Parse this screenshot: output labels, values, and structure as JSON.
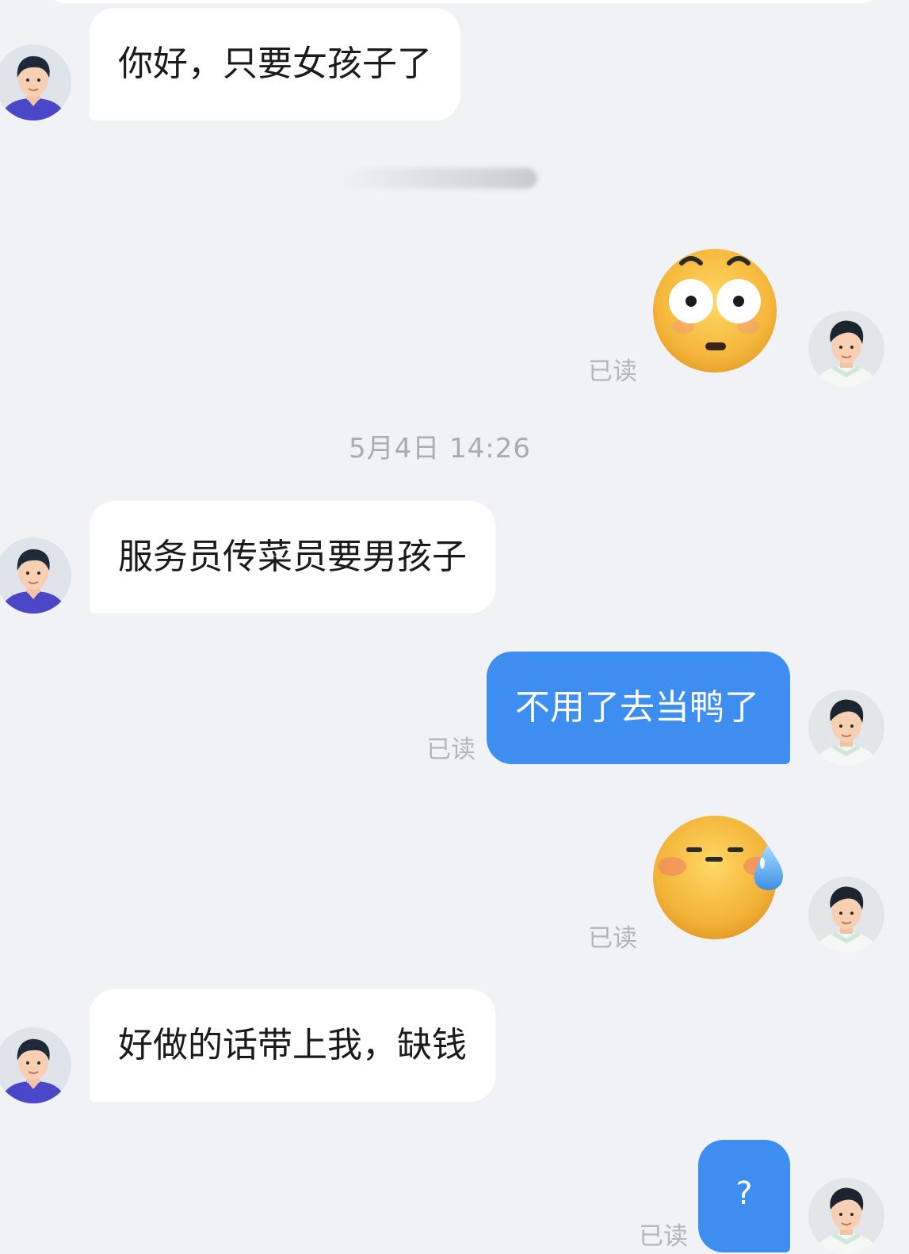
{
  "messages": [
    {
      "side": "incoming",
      "text": "你好，只要女孩子了"
    },
    {
      "side": "outgoing",
      "type": "sticker",
      "icon": "shocked-face-sticker",
      "status": "已读"
    },
    {
      "timestamp": "5月4日 14:26"
    },
    {
      "side": "incoming",
      "text": "服务员传菜员要男孩子"
    },
    {
      "side": "outgoing",
      "text": "不用了去当鸭了",
      "status": "已读"
    },
    {
      "side": "outgoing",
      "type": "sticker",
      "icon": "sweat-face-sticker",
      "status": "已读"
    },
    {
      "side": "incoming",
      "text": "好做的话带上我，缺钱"
    },
    {
      "side": "outgoing",
      "text": "?",
      "status": "已读"
    }
  ],
  "colors": {
    "background": "#f1f2f6",
    "incoming_bubble": "#ffffff",
    "outgoing_bubble": "#3d8ef0",
    "read_status": "#b3b5bb"
  }
}
